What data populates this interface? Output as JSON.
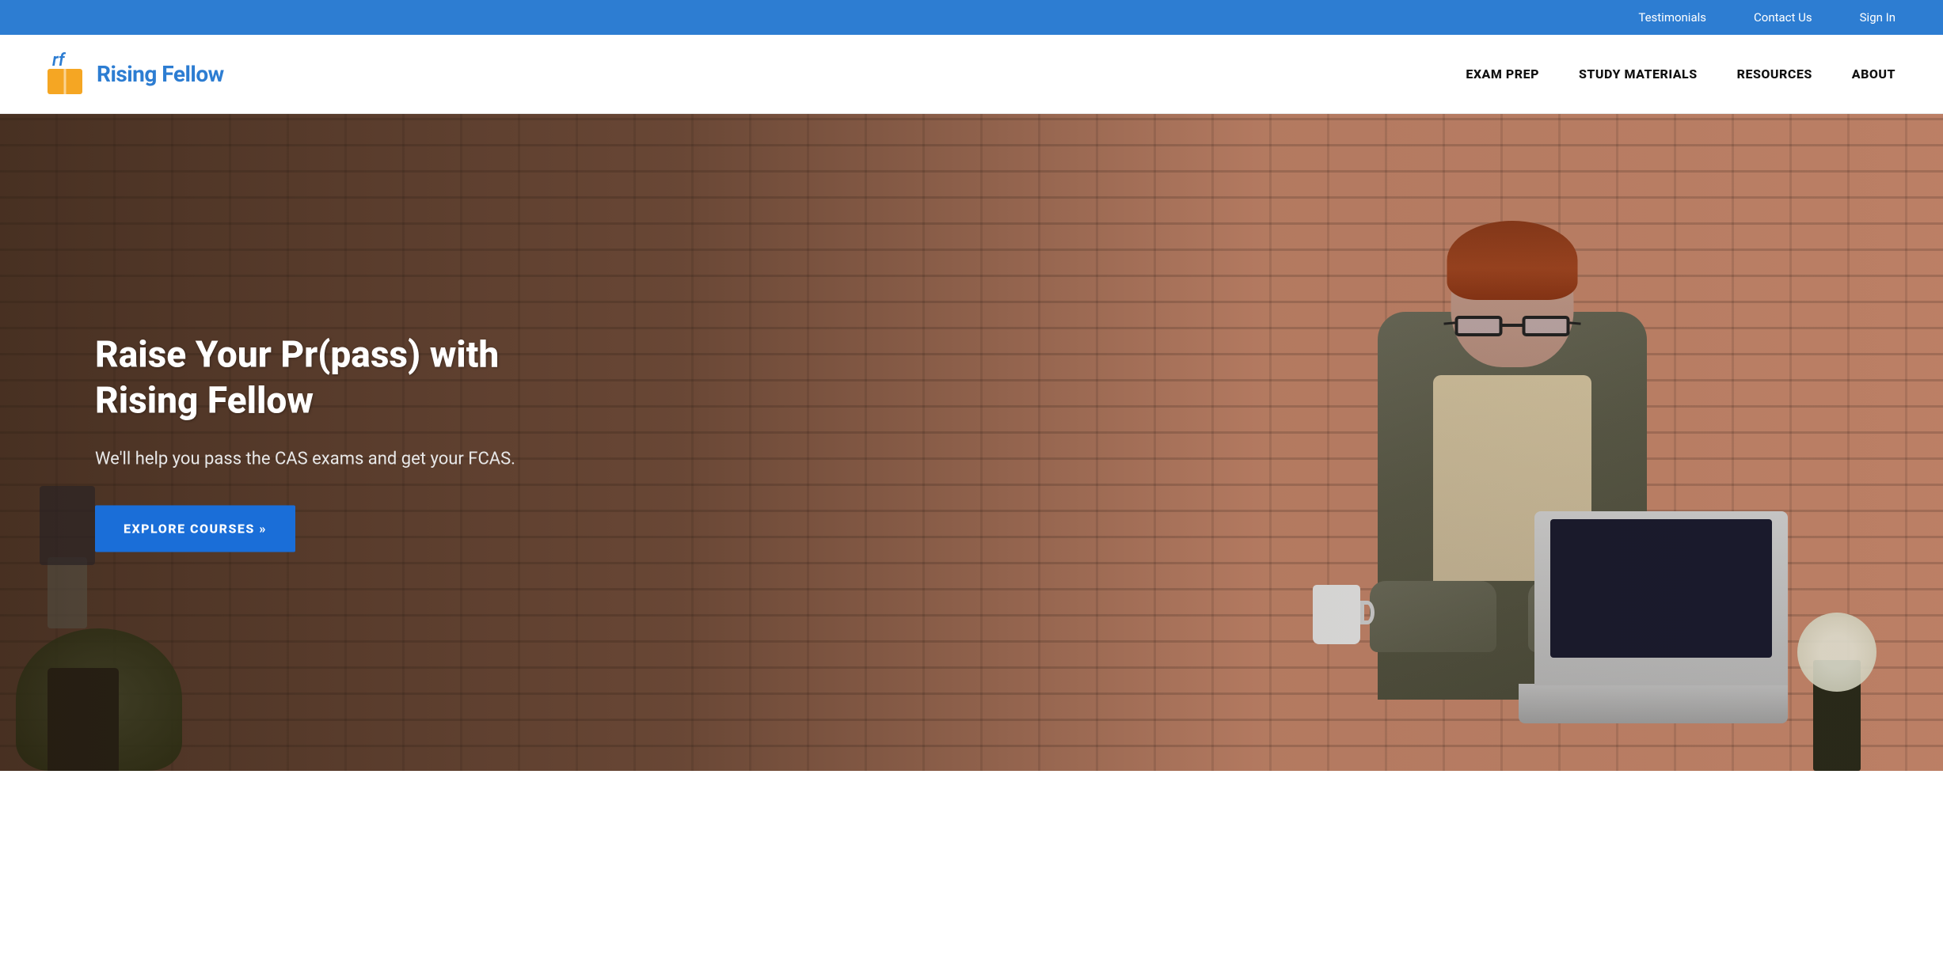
{
  "topbar": {
    "links": [
      {
        "id": "testimonials",
        "label": "Testimonials"
      },
      {
        "id": "contact",
        "label": "Contact Us"
      },
      {
        "id": "signin",
        "label": "Sign In"
      }
    ],
    "background": "#2D7DD2"
  },
  "header": {
    "logo": {
      "icon_text": "rf",
      "brand_name": "Rising Fellow"
    },
    "nav": {
      "items": [
        {
          "id": "exam-prep",
          "label": "EXAM PREP"
        },
        {
          "id": "study-materials",
          "label": "STUDY MATERIALS"
        },
        {
          "id": "resources",
          "label": "RESOURCES"
        },
        {
          "id": "about",
          "label": "ABOUT"
        }
      ]
    }
  },
  "hero": {
    "title": "Raise Your Pr(pass) with Rising Fellow",
    "subtitle": "We'll help you pass the CAS exams and get your FCAS.",
    "cta_label": "EXPLORE COURSES »"
  }
}
